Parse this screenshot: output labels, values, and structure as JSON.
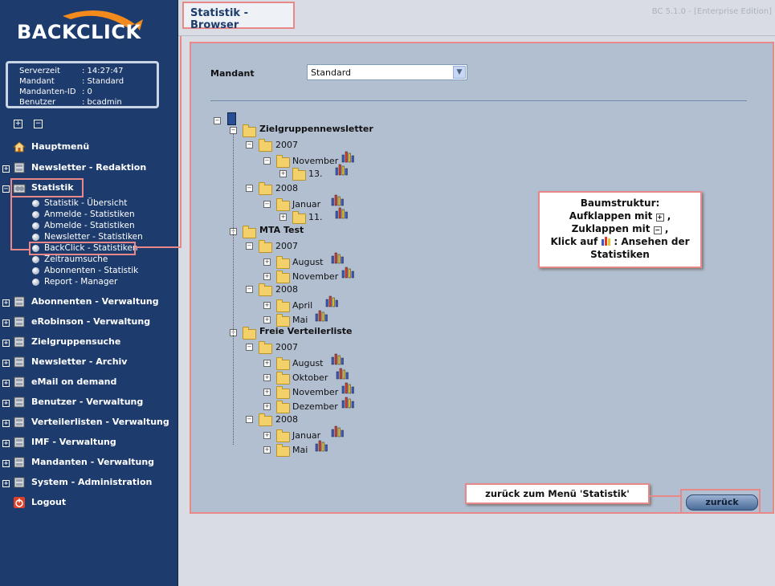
{
  "app": {
    "logo_text": "BACKCLICK",
    "page_title": "Statistik - Browser",
    "version": "BC 5.1.0 - [Enterprise Edition]"
  },
  "info": {
    "rows": [
      {
        "k": "Serverzeit",
        "v": ": 14:27:47"
      },
      {
        "k": "Mandant",
        "v": ": Standard"
      },
      {
        "k": "Mandanten-ID",
        "v": ": 0"
      },
      {
        "k": "Benutzer",
        "v": ": bcadmin"
      }
    ]
  },
  "nav": {
    "hauptmenu": "Hauptmenü",
    "items": [
      "Newsletter - Redaktion",
      "Statistik",
      "Abonnenten - Verwaltung",
      "eRobinson - Verwaltung",
      "Zielgruppensuche",
      "Newsletter - Archiv",
      "eMail on demand",
      "Benutzer - Verwaltung",
      "Verteilerlisten - Verwaltung",
      "IMF - Verwaltung",
      "Mandanten - Verwaltung",
      "System - Administration"
    ],
    "logout": "Logout",
    "sub": [
      "Statistik - Übersicht",
      "Anmelde - Statistiken",
      "Abmelde - Statistiken",
      "Newsletter - Statistiken",
      "BackClick - Statistiken",
      "Zeitraumsuche",
      "Abonnenten - Statistik",
      "Report - Manager"
    ]
  },
  "form": {
    "mandant_label": "Mandant",
    "mandant_value": "Standard"
  },
  "tree": {
    "groups": [
      {
        "label": "Zielgruppennewsletter",
        "years": [
          {
            "year": "2007",
            "months": [
              {
                "label": "November",
                "children": [
                  "13."
                ]
              }
            ]
          },
          {
            "year": "2008",
            "months": [
              {
                "label": "Januar",
                "children": [
                  "11."
                ]
              }
            ]
          }
        ]
      },
      {
        "label": "MTA Test",
        "years": [
          {
            "year": "2007",
            "months": [
              {
                "label": "August"
              },
              {
                "label": "November"
              }
            ]
          },
          {
            "year": "2008",
            "months": [
              {
                "label": "April"
              },
              {
                "label": "Mai"
              }
            ]
          }
        ]
      },
      {
        "label": "Freie Verteilerliste",
        "years": [
          {
            "year": "2007",
            "months": [
              {
                "label": "August"
              },
              {
                "label": "Oktober"
              },
              {
                "label": "November"
              },
              {
                "label": "Dezember"
              }
            ]
          },
          {
            "year": "2008",
            "months": [
              {
                "label": "Januar"
              },
              {
                "label": "Mai"
              }
            ]
          }
        ]
      }
    ]
  },
  "callout": {
    "line1": "Baumstruktur:",
    "line2a": "Aufklappen mit",
    "line2b": ",",
    "line3a": "Zuklappen mit",
    "line3b": ",",
    "line4a": "Klick auf",
    "line4b": ": Ansehen der",
    "line5": "Statistiken"
  },
  "callout2": "zurück zum Menü 'Statistik'",
  "button": {
    "zurueck": "zurück"
  }
}
